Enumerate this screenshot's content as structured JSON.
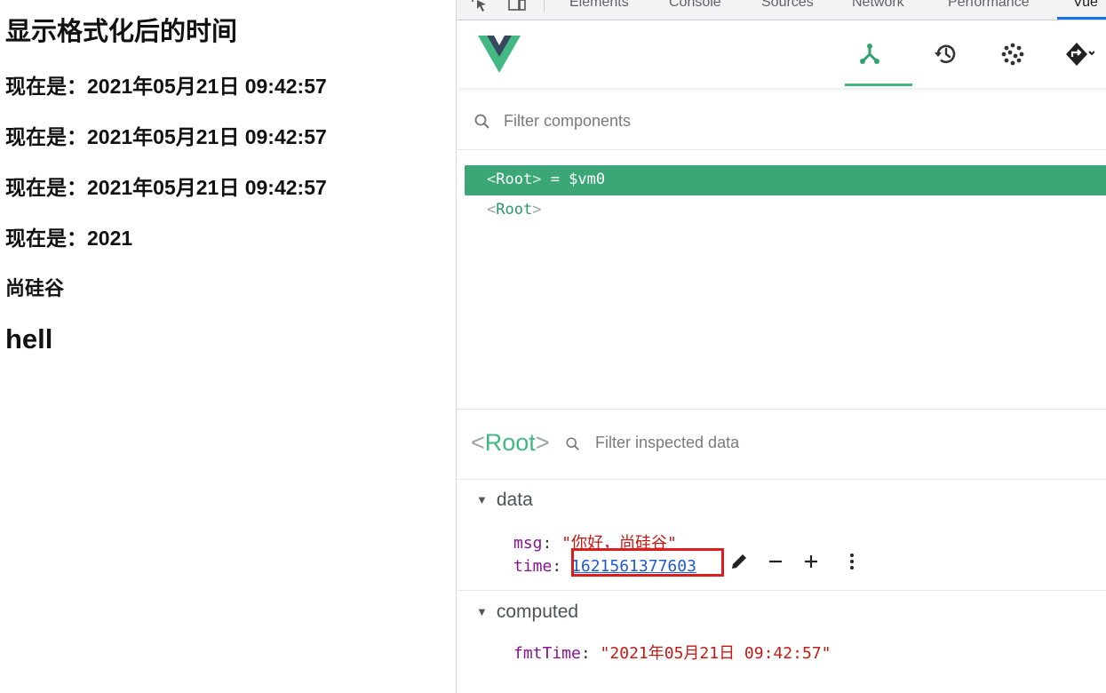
{
  "page": {
    "heading": "显示格式化后的时间",
    "lines": [
      "现在是：2021年05月21日 09:42:57",
      "现在是：2021年05月21日 09:42:57",
      "现在是：2021年05月21日 09:42:57",
      "现在是：2021",
      "尚硅谷"
    ],
    "big_text": "hell"
  },
  "devtools": {
    "tabs": [
      "Elements",
      "Console",
      "Sources",
      "Network",
      "Performance",
      "Vue"
    ],
    "active_tab": "Vue",
    "toolbar_icons": [
      "components-icon",
      "timeline-icon",
      "performance-icon",
      "router-icon"
    ],
    "filter_components_placeholder": "Filter components",
    "tree": {
      "selected": {
        "open": "<",
        "name": "Root",
        "close": ">",
        "suffix": " = $vm0"
      },
      "second": {
        "open": "<",
        "name": "Root",
        "close": ">"
      }
    },
    "inspector": {
      "title_open": "<",
      "title_name": "Root",
      "title_close": ">",
      "filter_placeholder": "Filter inspected data",
      "data_section": "data",
      "computed_section": "computed",
      "props": {
        "msg_key": "msg",
        "msg_value": "你好，尚硅谷",
        "time_key": "time",
        "time_value": "1621561377603",
        "fmt_key": "fmtTime",
        "fmt_value": "2021年05月21日 09:42:57"
      },
      "action_icons": [
        "edit-icon",
        "minus-icon",
        "plus-icon",
        "more-icon"
      ]
    }
  }
}
